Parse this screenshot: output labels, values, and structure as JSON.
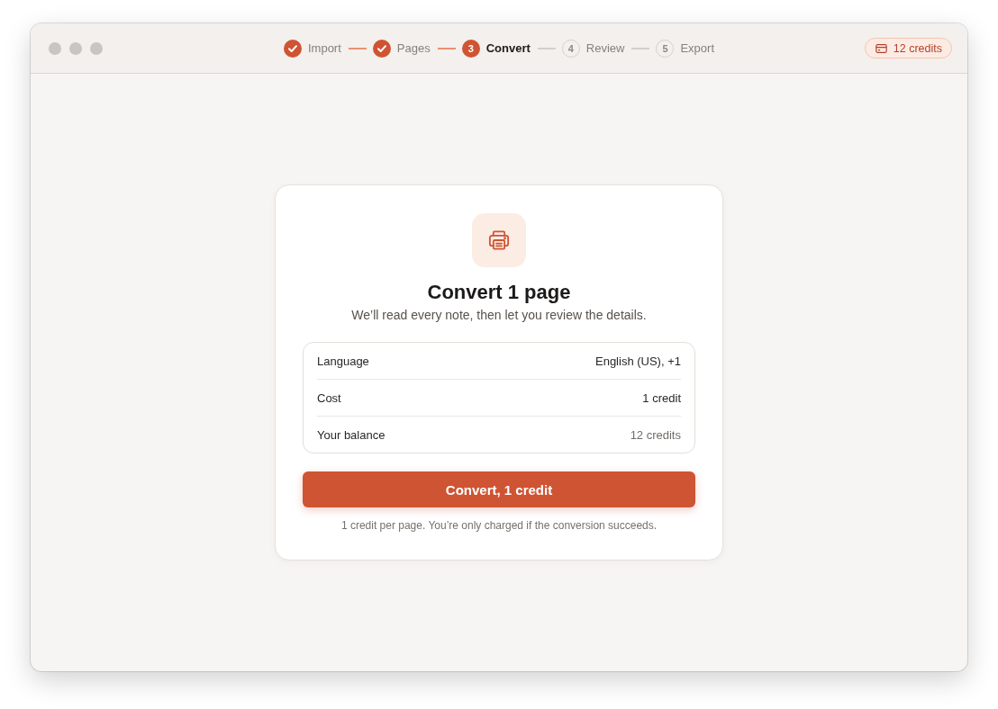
{
  "stepper": {
    "steps": [
      {
        "label": "Import",
        "completed": true,
        "selected": false
      },
      {
        "label": "Pages",
        "completed": true,
        "selected": false
      },
      {
        "label": "Convert",
        "number": "3",
        "completed": false,
        "selected": true
      },
      {
        "label": "Review",
        "number": "4",
        "completed": false,
        "selected": false
      },
      {
        "label": "Export",
        "number": "5",
        "completed": false,
        "selected": false
      }
    ]
  },
  "credits_badge": {
    "label": "12 credits"
  },
  "card": {
    "title": "Convert 1 page",
    "subtitle": "We’ll read every note, then let you review the details.",
    "details": [
      {
        "label": "Language",
        "value": "English (US), +1",
        "muted": false
      },
      {
        "label": "Cost",
        "value": "1 credit",
        "muted": false
      },
      {
        "label": "Your balance",
        "value": "12 credits",
        "muted": true
      }
    ],
    "primary_button": {
      "label": "Convert, 1 credit"
    },
    "footnote": "1 credit per page. You’re only charged if the conversion succeeds."
  }
}
